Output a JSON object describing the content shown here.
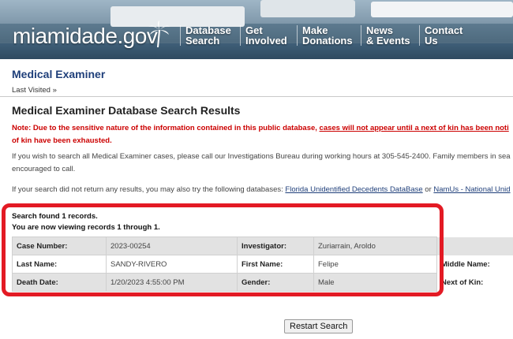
{
  "header": {
    "logo": "miamidade.gov",
    "nav": [
      {
        "label": "Database\nSearch"
      },
      {
        "label": "Get\nInvolved"
      },
      {
        "label": "Make\nDonations"
      },
      {
        "label": "News\n& Events"
      },
      {
        "label": "Contact\nUs"
      }
    ]
  },
  "page": {
    "title": "Medical Examiner",
    "last_visited": "Last Visited »",
    "results_title": "Medical Examiner Database Search Results"
  },
  "note": {
    "part1": "Note: Due to the sensitive nature of the information contained in this public database, ",
    "link": "cases will not appear until a next of kin has been noti",
    "part2": "of kin have been exhausted."
  },
  "info": {
    "line1": "If you wish to search all Medical Examiner cases, please call our Investigations Bureau during working hours at 305-545-2400. Family members in sea",
    "line2": "encouraged to call.",
    "line3_pre": "If your search did not return any results, you may also try the following databases: ",
    "link1": "Florida Unidentified Decedents DataBase",
    "or": " or ",
    "link2": "NamUs - National Unid"
  },
  "results": {
    "found": "Search found 1 records.",
    "viewing": "You are now viewing records 1 through 1.",
    "case_number_label": "Case Number:",
    "case_number": "2023-00254",
    "investigator_label": "Investigator:",
    "investigator": "Zuriarrain, Aroldo",
    "last_name_label": "Last Name:",
    "last_name": "SANDY-RIVERO",
    "first_name_label": "First Name:",
    "first_name": "Felipe",
    "middle_name_label": "Middle Name:",
    "death_date_label": "Death Date:",
    "death_date": "1/20/2023 4:55:00 PM",
    "gender_label": "Gender:",
    "gender": "Male",
    "next_of_kin_label": "Next of Kin:"
  },
  "buttons": {
    "restart": "Restart Search"
  },
  "colors": {
    "title_blue": "#1f3f7a",
    "note_red": "#cc0000",
    "highlight_red": "#e31a24",
    "row_shade": "#e2e2e2"
  }
}
